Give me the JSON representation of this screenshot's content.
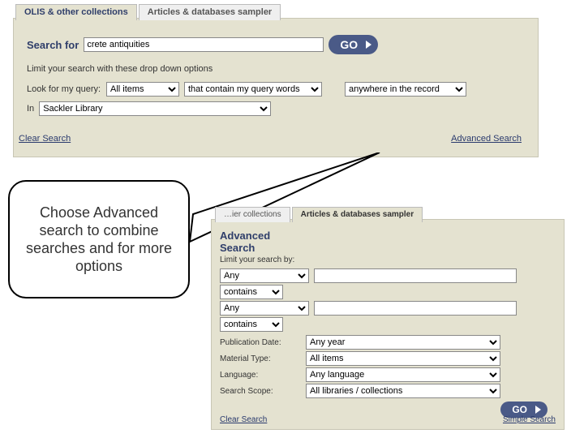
{
  "tabs": {
    "active": "OLIS & other collections",
    "inactive": "Articles & databases sampler"
  },
  "simple": {
    "searchForLabel": "Search for",
    "query": "crete antiquities",
    "goLabel": "GO",
    "limitHint": "Limit your search with these drop down options",
    "lookForLabel": "Look for my query:",
    "itemTypeSel": "All items",
    "matchSel": "that contain my query words",
    "scopeSel": "anywhere in the record",
    "inLabel": "In",
    "librarySel": "Sackler Library",
    "clearLink": "Clear Search",
    "advancedLink": "Advanced Search"
  },
  "advanced": {
    "tabs": {
      "inactive": "…ier collections",
      "active": "Articles & databases sampler"
    },
    "title1": "Advanced",
    "title2": "Search",
    "limitLabel": "Limit your search by:",
    "field1": "Any",
    "op1": "contains",
    "field2": "Any",
    "op2": "contains",
    "pubDateLabel": "Publication Date:",
    "pubDateVal": "Any year",
    "matTypeLabel": "Material Type:",
    "matTypeVal": "All items",
    "langLabel": "Language:",
    "langVal": "Any language",
    "scopeLabel": "Search Scope:",
    "scopeVal": "All libraries / collections",
    "goLabel": "GO",
    "clearLink": "Clear Search",
    "simpleLink": "Simple Search"
  },
  "callout": "Choose Advanced search to combine searches and for more options"
}
